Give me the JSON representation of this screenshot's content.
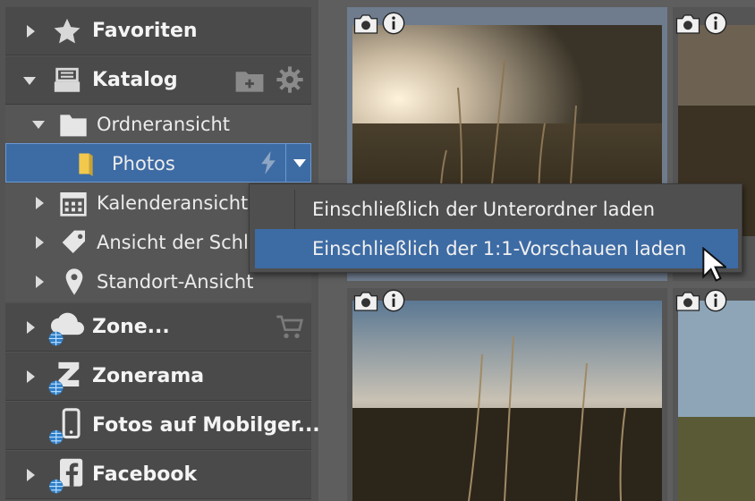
{
  "sidebar": {
    "favorites": {
      "label": "Favoriten",
      "icon": "star-icon"
    },
    "catalog": {
      "label": "Katalog",
      "icon": "catalog-icon",
      "actions": [
        {
          "icon": "add-folder-icon"
        },
        {
          "icon": "gear-icon"
        }
      ],
      "items": [
        {
          "label": "Ordneransicht",
          "icon": "folder-icon"
        },
        {
          "label": "Photos",
          "icon": "folder-yellow-icon",
          "selected": true
        },
        {
          "label": "Kalenderansicht",
          "icon": "calendar-icon"
        },
        {
          "label": "Ansicht der Schl",
          "icon": "tag-icon"
        },
        {
          "label": "Standort-Ansicht",
          "icon": "location-pin-icon"
        }
      ]
    },
    "sections": [
      {
        "label": "Zone...",
        "icon": "cloud-icon"
      },
      {
        "label": "Zonerama",
        "icon": "zonerama-icon"
      },
      {
        "label": "Fotos auf Mobilger...",
        "icon": "phone-icon"
      },
      {
        "label": "Facebook",
        "icon": "facebook-icon"
      }
    ]
  },
  "context_menu": {
    "items": [
      {
        "label": "Einschließlich der Unterordner laden"
      },
      {
        "label": "Einschließlich der 1:1-Vorschauen laden",
        "highlighted": true
      }
    ]
  },
  "colors": {
    "selection": "#3d6ba4",
    "panel": "#4a4a4a",
    "background": "#5a5a5a"
  }
}
